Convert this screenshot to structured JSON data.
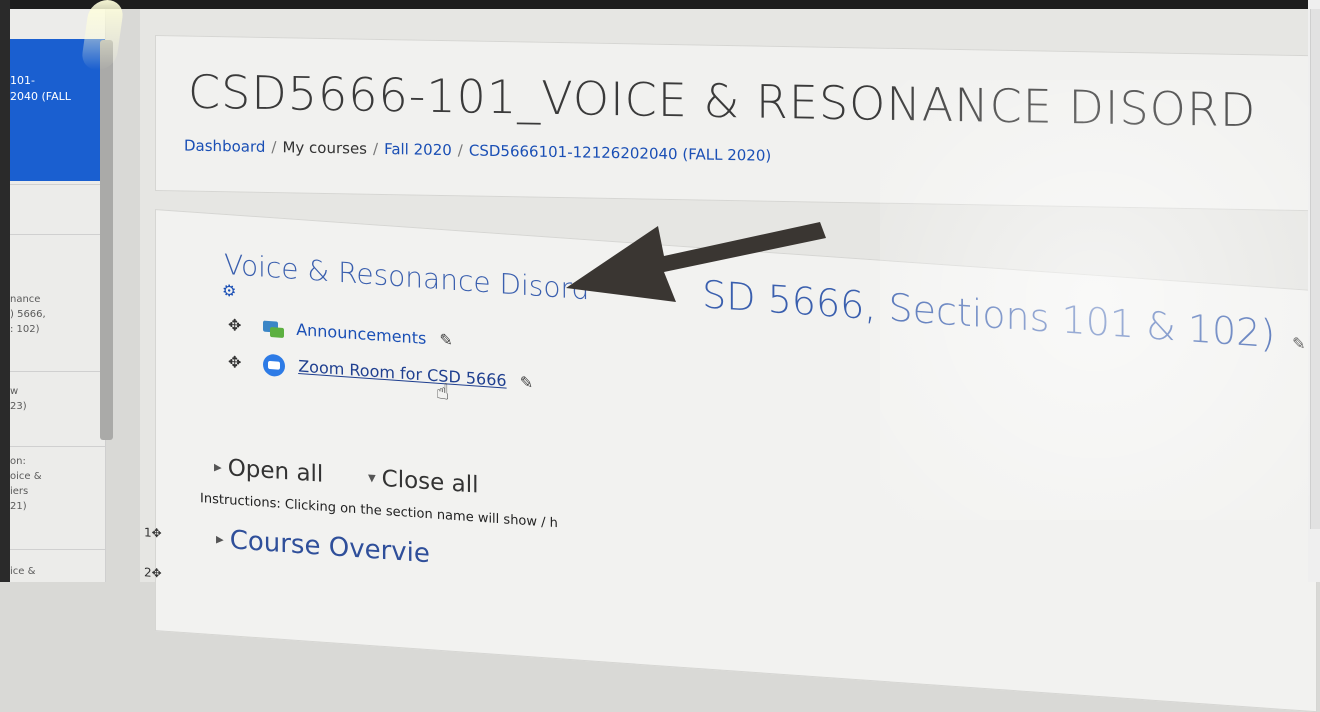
{
  "sidebar": {
    "active_item": [
      "101-",
      "2040 (FALL"
    ],
    "fragments": [
      [
        "nance",
        ") 5666,",
        ": 102)"
      ],
      [
        "w",
        "23)"
      ],
      [
        "on:",
        "oice &",
        "iers",
        "21)"
      ],
      [
        "ice &"
      ]
    ]
  },
  "header": {
    "title": "CSD5666-101_VOICE & RESONANCE DISORD",
    "breadcrumb": [
      {
        "label": "Dashboard"
      },
      {
        "label": "My courses"
      },
      {
        "label": "Fall 2020"
      },
      {
        "label": "CSD5666101-12126202040 (FALL 2020)"
      }
    ]
  },
  "section": {
    "title_part1": "Voice & Resonance Disord",
    "title_part2": "SD 5666, Sections 101 & 102)"
  },
  "activities": [
    {
      "label": "Announcements",
      "icon": "forum-icon"
    },
    {
      "label": "Zoom Room for CSD 5666",
      "icon": "zoom-icon"
    }
  ],
  "controls": {
    "open_all": "Open all",
    "close_all": "Close all"
  },
  "instructions": "Instructions: Clicking on the section name will show / h",
  "sections": {
    "numbers": [
      "1",
      "2"
    ],
    "course_overview": "Course Overvie"
  },
  "colors": {
    "link": "#1a4fb5",
    "nav_active": "#1a5fd0",
    "arrow": "#3a3632"
  }
}
